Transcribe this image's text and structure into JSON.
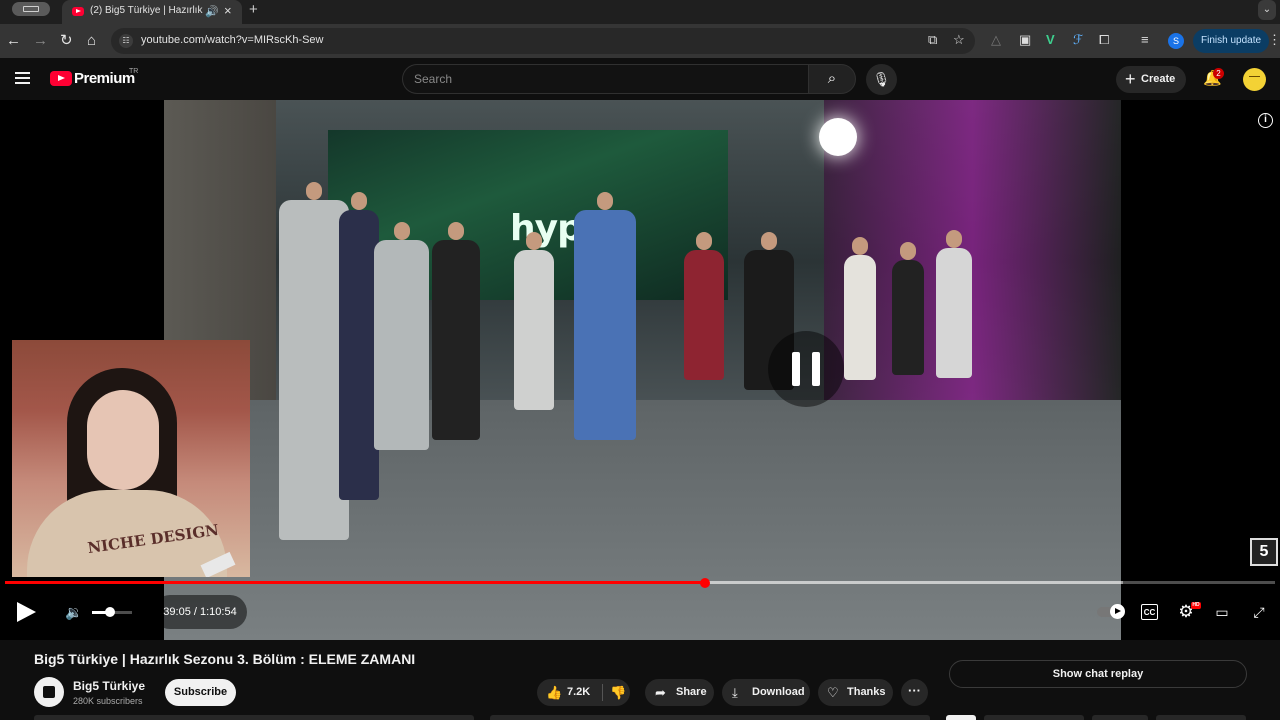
{
  "browser": {
    "tab_title": "(2) Big5 Türkiye | Hazırlık",
    "new_tab": "+",
    "url": "youtube.com/watch?v=MIRscKh-Sew",
    "profile_initial": "S",
    "finish_update_label": "Finish update"
  },
  "masthead": {
    "logo_text": "Premium",
    "country_code": "TR",
    "search_placeholder": "Search",
    "create_label": "Create",
    "notification_count": "2"
  },
  "player": {
    "state": "playing",
    "current_time": "39:05",
    "duration": "1:10:54",
    "time_display": "39:05 / 1:10:54",
    "progress_fraction": 0.551,
    "buffered_fraction": 0.88,
    "volume_fraction": 0.45,
    "video_sign_text": "hype",
    "facecam_shirt_text": "NICHE DESIGN",
    "channel_watermark": "5",
    "accent_color": "#ff0000"
  },
  "video": {
    "title": "Big5 Türkiye | Hazırlık Sezonu 3. Bölüm : ELEME ZAMANI",
    "channel_name": "Big5 Türkiye",
    "subscribers": "280K subscribers",
    "subscribe_label": "Subscribe",
    "likes": "7.2K",
    "share_label": "Share",
    "download_label": "Download",
    "thanks_label": "Thanks",
    "chat_replay_label": "Show chat replay"
  }
}
